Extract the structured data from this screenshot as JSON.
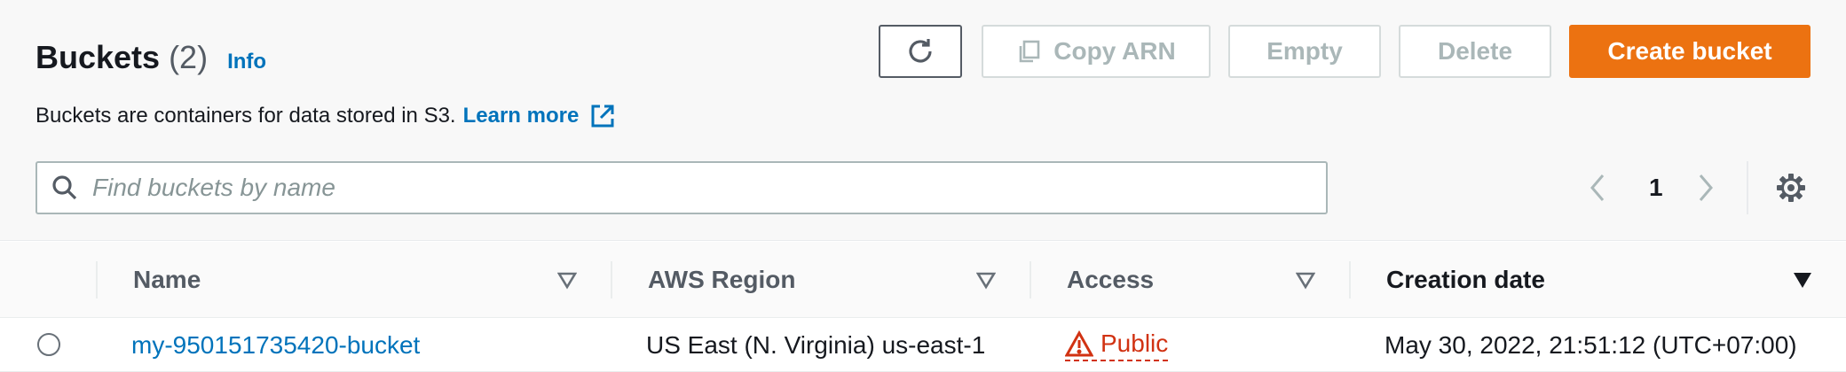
{
  "header": {
    "title": "Buckets",
    "count": "(2)",
    "info_label": "Info",
    "description": "Buckets are containers for data stored in S3.",
    "learn_more": "Learn more"
  },
  "toolbar": {
    "copy_arn_label": "Copy ARN",
    "empty_label": "Empty",
    "delete_label": "Delete",
    "create_label": "Create bucket"
  },
  "search": {
    "placeholder": "Find buckets by name",
    "value": ""
  },
  "pagination": {
    "current_page": "1"
  },
  "table": {
    "columns": [
      "Name",
      "AWS Region",
      "Access",
      "Creation date"
    ],
    "rows": [
      {
        "name": "my-950151735420-bucket",
        "region": "US East (N. Virginia) us-east-1",
        "access": "Public",
        "created": "May 30, 2022, 21:51:12 (UTC+07:00)"
      }
    ]
  },
  "colors": {
    "accent": "#0073bb",
    "primary_button": "#ec7211",
    "warning": "#d13212",
    "disabled": "#aab7b8"
  },
  "icons": [
    "refresh-icon",
    "copy-icon",
    "external-link-icon",
    "search-icon",
    "chevron-left-icon",
    "chevron-right-icon",
    "settings-gear-icon",
    "sort-triangle-icon",
    "warning-icon"
  ]
}
